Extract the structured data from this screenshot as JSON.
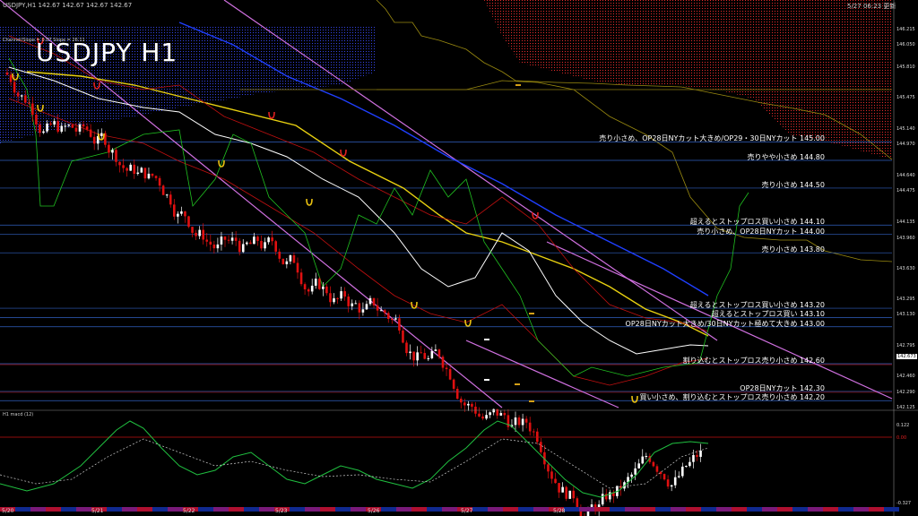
{
  "header": {
    "symbol_info": "USDJPY,H1  142.67 142.67 142.67 142.67",
    "timestamp": "5/27 06:23 更新",
    "channel_label": "Channel/Slope = 0.07 Slope = 26.11",
    "big_title": "USDJPY H1",
    "macd_label": "H1  macd (12)"
  },
  "chart_data": {
    "type": "line",
    "title": "USDJPY H1",
    "price_axis": [
      "146.215",
      "146.050",
      "145.810",
      "145.475",
      "145.140",
      "144.970",
      "144.640",
      "144.475",
      "144.135",
      "143.960",
      "143.630",
      "143.295",
      "143.130",
      "142.795",
      "142.460",
      "142.290",
      "142.125"
    ],
    "current_price": "142.673",
    "macd_axis": [
      "0.122",
      "0.00",
      "-0.327"
    ],
    "dates": [
      "5/20",
      "5/21",
      "5/22",
      "5/23",
      "5/26",
      "5/27",
      "5/28"
    ],
    "levels": [
      {
        "price": 145.0,
        "label": "売り小さめ、OP28日NYカット大きめ/OP29・30日NYカット 145.00"
      },
      {
        "price": 144.8,
        "label": "売りやや小さめ 144.80"
      },
      {
        "price": 144.5,
        "label": "売り小さめ 144.50"
      },
      {
        "price": 144.1,
        "label": "超えるとストップロス買い小さめ 144.10"
      },
      {
        "price": 144.0,
        "label": "売り小さめ、OP28日NYカット 144.00"
      },
      {
        "price": 143.8,
        "label": "売り小さめ 143.80"
      },
      {
        "price": 143.2,
        "label": "超えるとストップロス買い小さめ 143.20"
      },
      {
        "price": 143.1,
        "label": "超えるとストップロス買い 143.10"
      },
      {
        "price": 143.0,
        "label": "OP28日NYカット大きめ/30日NYカット極めて大きめ 143.00"
      },
      {
        "price": 142.6,
        "label": "割り込むとストップロス売り小さめ 142.60"
      },
      {
        "price": 142.3,
        "label": "OP28日NYカット 142.30"
      },
      {
        "price": 142.2,
        "label": "買い小さめ、割り込むとストップロス売り小さめ 142.20"
      }
    ],
    "box_labels": [
      {
        "text": "VAH",
        "color": "#d4a017"
      },
      {
        "text": "VDH",
        "color": "#d4a017"
      },
      {
        "text": "VDC",
        "color": "#ffffff"
      },
      {
        "text": "VDO",
        "color": "#ffffff"
      },
      {
        "text": "VAL",
        "color": "#d4a017"
      },
      {
        "text": "VDL",
        "color": "#d4a017"
      }
    ],
    "wave_numbers": [
      "3",
      "4",
      "5"
    ],
    "colors": {
      "bull": "#ffffff",
      "bear": "#e01010",
      "ma_fast": "#ffffff",
      "ma_mid": "#e8d010",
      "ma_slow": "#1f3fff",
      "channel": "#d070e0",
      "chikou": "#20c020",
      "bollinger": "#c01010",
      "level_line": "#3060c0",
      "kumo_red": "#8b1010",
      "kumo_blue": "#1a2a8a",
      "macd": "#20c040",
      "macd_neg": "#e070a0",
      "signal": "#cccccc"
    }
  }
}
